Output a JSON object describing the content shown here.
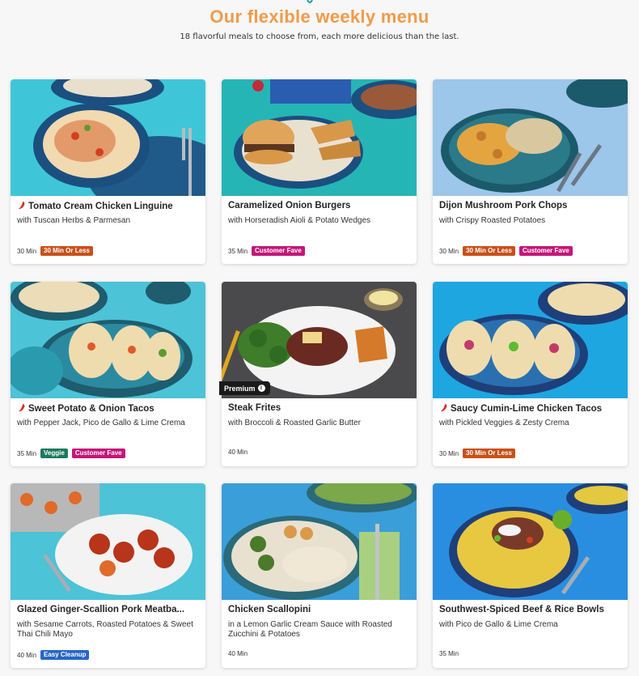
{
  "header": {
    "title": "Our flexible weekly menu",
    "subtitle": "18 flavorful meals to choose from, each more delicious than the last."
  },
  "colors": {
    "title_orange": "#f29a4a",
    "badge_30min": "#c8501a",
    "badge_customer_fave": "#c4167a",
    "badge_veggie": "#1c7a5e",
    "badge_easy_cleanup": "#2666c4",
    "spicy_red": "#d7301f"
  },
  "cards": [
    {
      "title": "Tomato Cream Chicken Linguine",
      "subtitle": "with Tuscan Herbs & Parmesan",
      "time": "30 Min",
      "spicy": true,
      "badges": [
        "30 Min Or Less"
      ]
    },
    {
      "title": "Caramelized Onion Burgers",
      "subtitle": "with Horseradish Aioli & Potato Wedges",
      "time": "35 Min",
      "spicy": false,
      "badges": [
        "Customer Fave"
      ]
    },
    {
      "title": "Dijon Mushroom Pork Chops",
      "subtitle": "with Crispy Roasted Potatoes",
      "time": "30 Min",
      "spicy": false,
      "badges": [
        "30 Min Or Less",
        "Customer Fave"
      ]
    },
    {
      "title": "Sweet Potato & Onion Tacos",
      "subtitle": "with Pepper Jack, Pico de Gallo & Lime Crema",
      "time": "35 Min",
      "spicy": true,
      "badges": [
        "Veggie",
        "Customer Fave"
      ]
    },
    {
      "title": "Steak Frites",
      "subtitle": "with Broccoli & Roasted Garlic Butter",
      "time": "40 Min",
      "spicy": false,
      "premium": "Premium",
      "badges": []
    },
    {
      "title": "Saucy Cumin-Lime Chicken Tacos",
      "subtitle": "with Pickled Veggies & Zesty Crema",
      "time": "30 Min",
      "spicy": true,
      "badges": [
        "30 Min Or Less"
      ]
    },
    {
      "title": "Glazed Ginger-Scallion Pork Meatba...",
      "subtitle": "with Sesame Carrots, Roasted Potatoes & Sweet Thai Chili Mayo",
      "time": "40 Min",
      "spicy": false,
      "badges": [
        "Easy Cleanup"
      ]
    },
    {
      "title": "Chicken Scallopini",
      "subtitle": "in a Lemon Garlic Cream Sauce with Roasted Zucchini & Potatoes",
      "time": "40 Min",
      "spicy": false,
      "badges": []
    },
    {
      "title": "Southwest-Spiced Beef & Rice Bowls",
      "subtitle": "with Pico de Gallo & Lime Crema",
      "time": "35 Min",
      "spicy": false,
      "badges": []
    }
  ]
}
